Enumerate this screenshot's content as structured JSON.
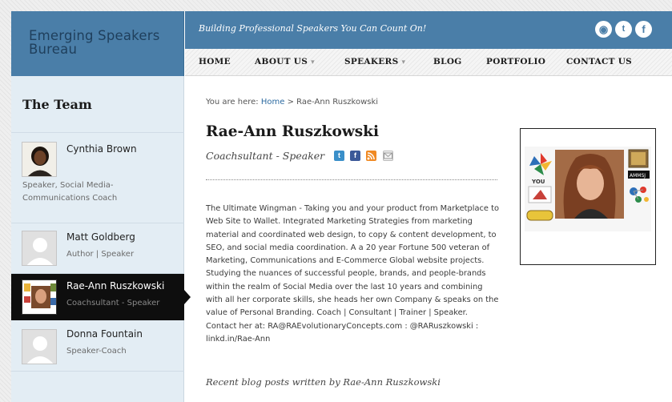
{
  "header": {
    "logo_text": "Emerging Speakers Bureau",
    "tagline": "Building Professional Speakers You Can Count On!",
    "social": [
      {
        "icon": "rss-icon",
        "glyph": "◉"
      },
      {
        "icon": "twitter-icon",
        "glyph": "t"
      },
      {
        "icon": "facebook-icon",
        "glyph": "f"
      }
    ]
  },
  "nav": {
    "items": [
      {
        "label": "HOME"
      },
      {
        "label": "ABOUT US",
        "caret": "▾"
      },
      {
        "label": "SPEAKERS",
        "caret": "▾"
      },
      {
        "label": "BLOG"
      },
      {
        "label": "PORTFOLIO"
      },
      {
        "label": "CONTACT US"
      }
    ]
  },
  "sidebar": {
    "title": "The Team",
    "members": [
      {
        "name": "Cynthia Brown",
        "role": "Speaker, Social Media-Communications Coach",
        "photo": "portrait",
        "active": false
      },
      {
        "name": "Matt Goldberg",
        "role": "Author | Speaker",
        "photo": "placeholder",
        "active": false
      },
      {
        "name": "Rae-Ann Ruszkowski",
        "role": "Coachsultant - Speaker",
        "photo": "collage",
        "active": true
      },
      {
        "name": "Donna Fountain",
        "role": "Speaker-Coach",
        "photo": "placeholder",
        "active": false
      }
    ]
  },
  "main": {
    "breadcrumb": {
      "prefix": "You are here: ",
      "home": "Home",
      "separator": " > ",
      "current": "Rae-Ann Ruszkowski"
    },
    "title": "Rae-Ann Ruszkowski",
    "subtitle": "Coachsultant - Speaker",
    "profile_icons": [
      "twitter-icon",
      "facebook-icon",
      "rss-icon",
      "email-icon"
    ],
    "bio": "The Ultimate Wingman - Taking you and your product from Marketplace to Web Site to Wallet. Integrated Marketing Strategies from marketing material and coordinated web design, to copy & content development, to SEO, and social media coordination. A a 20 year Fortune 500 veteran of Marketing, Communications and E-Commerce Global website projects. Studying the nuances of successful people, brands, and people-brands within the realm of Social Media over the last 10 years and combining with all her corporate skills, she heads her own Company & speaks on the value of Personal Branding. Coach | Consultant | Trainer | Speaker. Contact her at: RA@RAEvolutionaryConcepts.com : @RARuszkowski : linkd.in/Rae-Ann",
    "recent_posts": "Recent blog posts written by Rae-Ann Ruszkowski"
  },
  "colors": {
    "header_blue": "#4a7ea8",
    "link_blue": "#2c6aa0",
    "active_bg": "#0e0e0e"
  }
}
